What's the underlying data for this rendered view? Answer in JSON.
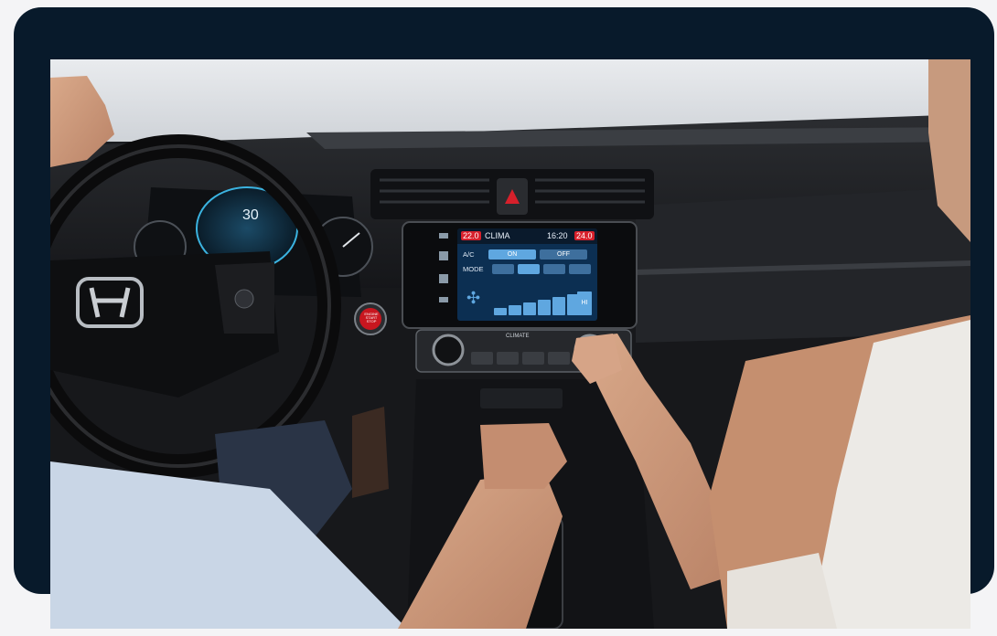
{
  "screen": {
    "temp_left": "22.0",
    "title": "CLIMA",
    "clock": "16:20",
    "temp_right": "24.0",
    "ac_label": "A/C",
    "ac_on": "ON",
    "ac_off": "OFF",
    "mode_label": "MODE",
    "fan_hi": "HI",
    "fan_level": 0.85
  },
  "dash": {
    "climate_label": "CLIMATE",
    "start_label": "ENGINE START STOP"
  },
  "colors": {
    "card": "#081a2b",
    "screen_blue": "#0c2f52",
    "accent": "#5fa7e0",
    "red_button": "#c8161f"
  }
}
